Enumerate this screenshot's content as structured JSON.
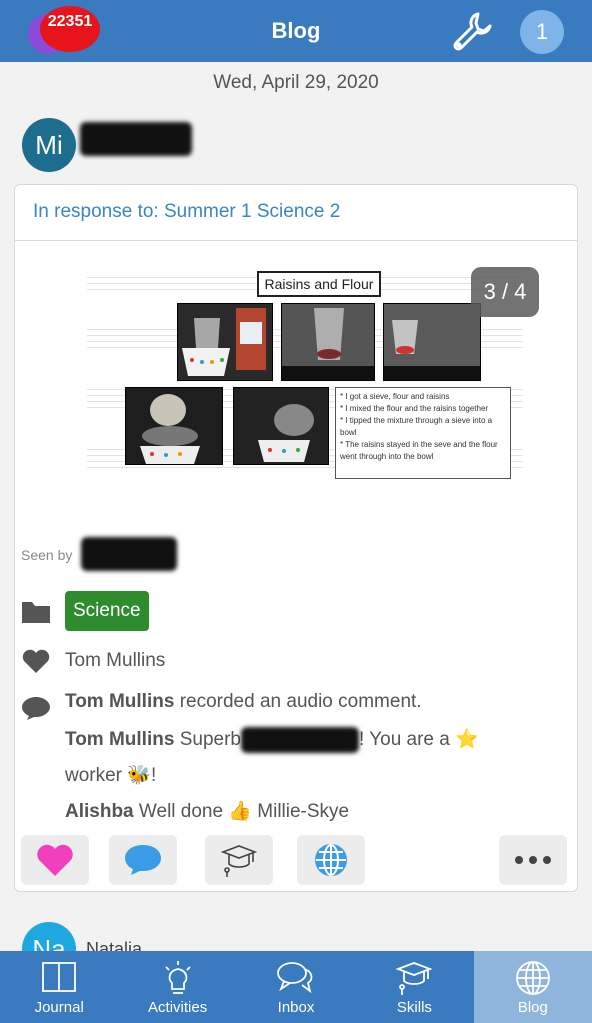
{
  "header": {
    "badge_count": "22351",
    "title": "Blog",
    "user_number": "1"
  },
  "post": {
    "date": "Wed, April 29, 2020",
    "author_initials": "Mi",
    "response_label": "In response to: Summer 1 Science 2",
    "image_counter": "3 / 4",
    "worksheet": {
      "title": "Raisins and Flour",
      "notes": [
        "* I got a sieve, flour and raisins",
        "* I mixed the flour and the raisins together",
        "* I tipped the mixture through a sieve into a bowl",
        "* The raisins stayed in the seve and the flour went through into the bowl"
      ]
    },
    "seen_by": "Seen by",
    "folder_tag": "Science",
    "likes": "Tom Mullins",
    "comments": [
      {
        "author": "Tom Mullins",
        "text": "recorded an audio comment."
      },
      {
        "author": "Tom Mullins",
        "text_a": "Superb",
        "text_b": "! You are a ⭐",
        "text_c": "worker 🐝!"
      },
      {
        "author": "Alishba",
        "text": "Well done 👍 Millie-Skye"
      }
    ],
    "actions": [
      "heart-icon",
      "comment-icon",
      "skills-icon",
      "globe-icon",
      "more-icon"
    ]
  },
  "next_post": {
    "author_initials": "Na",
    "author_name": "Natalia"
  },
  "nav": [
    {
      "label": "Journal",
      "icon": "book-icon"
    },
    {
      "label": "Activities",
      "icon": "lightbulb-icon"
    },
    {
      "label": "Inbox",
      "icon": "chat-icon"
    },
    {
      "label": "Skills",
      "icon": "graduation-icon"
    },
    {
      "label": "Blog",
      "icon": "globe-icon"
    }
  ],
  "colors": {
    "primary": "#3a7bbf",
    "tag_green": "#2e8b2e",
    "link_blue": "#3a85c4",
    "heart_pink": "#f23fc0",
    "comment_blue": "#3a9be6"
  }
}
